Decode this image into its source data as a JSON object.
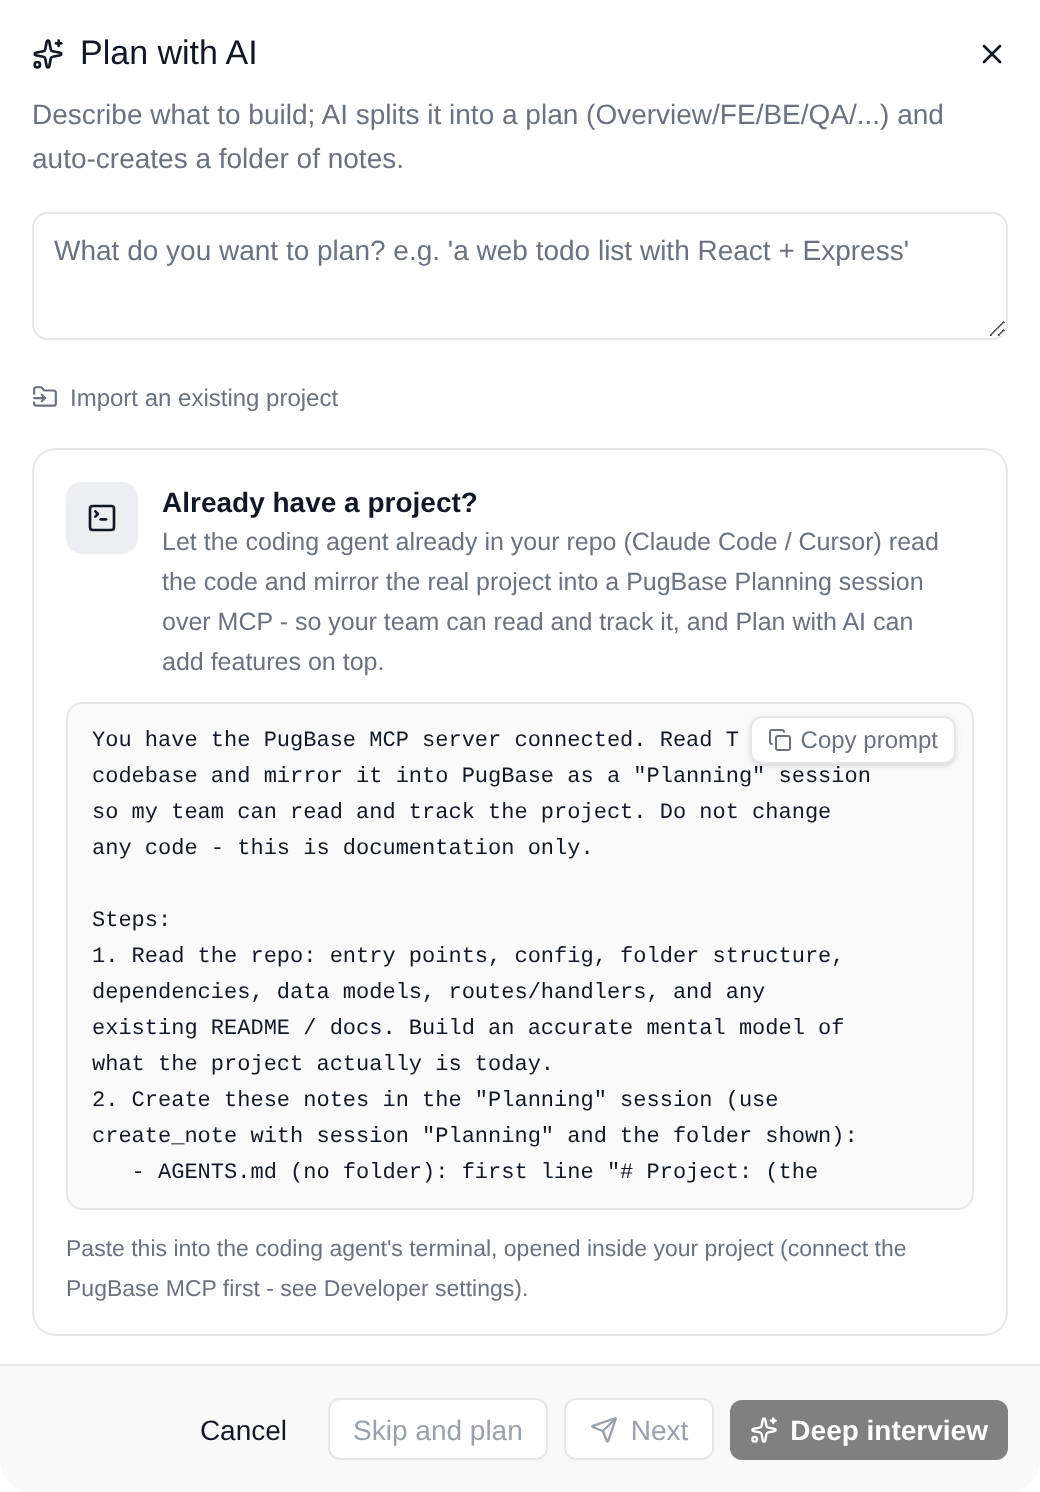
{
  "dialog": {
    "title": "Plan with AI",
    "description": "Describe what to build; AI splits it into a plan (Overview/FE/BE/QA/...) and auto-creates a folder of notes."
  },
  "prompt_field": {
    "placeholder": "What do you want to plan? e.g. 'a web todo list with React + Express'"
  },
  "import_link": {
    "label": "Import an existing project"
  },
  "import_card": {
    "title": "Already have a project?",
    "description": "Let the coding agent already in your repo (Claude Code / Cursor) read the code and mirror the real project into a PugBase Planning session over MCP - so your team can read and track it, and Plan with AI can add features on top.",
    "code_paragraphs": [
      [
        "You have the PugBase MCP server connected. Read T",
        "codebase and mirror it into PugBase as a \"Planning\" session",
        "so my team can read and track the project. Do not change",
        "any code - this is documentation only."
      ],
      [
        "Steps:",
        "1. Read the repo: entry points, config, folder structure,",
        "dependencies, data models, routes/handlers, and any",
        "existing README / docs. Build an accurate mental model of",
        "what the project actually is today.",
        "2. Create these notes in the \"Planning\" session (use",
        "create_note with session \"Planning\" and the folder shown):",
        "   - AGENTS.md (no folder): first line \"# Project: (the"
      ]
    ],
    "copy_button": {
      "label": "Copy prompt"
    },
    "hint": "Paste this into the coding agent's terminal, opened inside your project (connect the PugBase MCP first - see Developer settings)."
  },
  "footer_buttons": [
    {
      "kind": "cancel",
      "label": "Cancel",
      "disabled": false
    },
    {
      "kind": "outline",
      "label": "Skip and plan",
      "disabled": true
    },
    {
      "kind": "next",
      "label": "Next",
      "disabled": true
    },
    {
      "kind": "primary",
      "label": "Deep interview",
      "disabled": true
    }
  ]
}
